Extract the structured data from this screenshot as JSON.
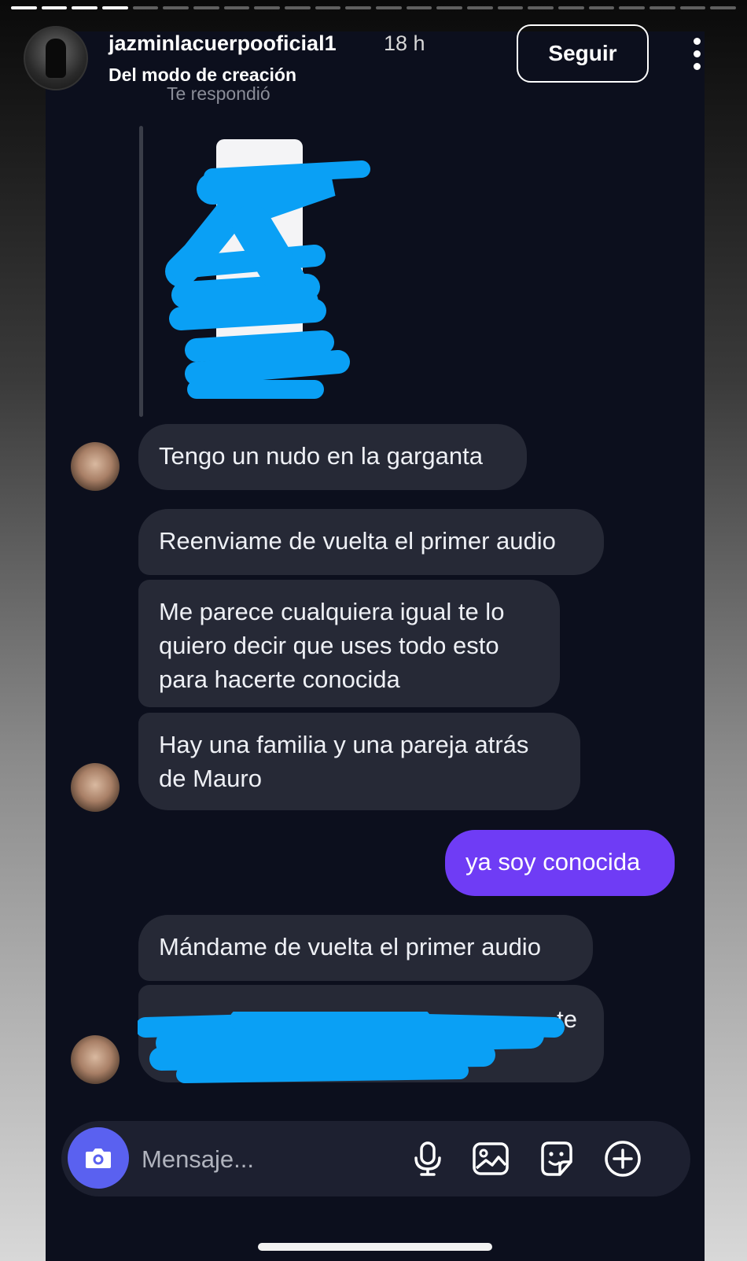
{
  "header": {
    "username": "jazminlacuerpooficial1",
    "time": "18 h",
    "subtitle": "Del modo de creación",
    "follow_label": "Seguir"
  },
  "thread": {
    "replied_label": "Te respondió",
    "messages": [
      {
        "text": "Tengo un nudo en la garganta",
        "from": "them"
      },
      {
        "text": "Reenviame de vuelta el primer audio",
        "from": "them"
      },
      {
        "text": "Me parece cualquiera igual te lo quiero decir que uses todo esto para hacerte conocida",
        "from": "them"
      },
      {
        "text": "Hay una familia y una pareja atrás de Mauro",
        "from": "them"
      },
      {
        "text": "ya soy conocida",
        "from": "me"
      },
      {
        "text": "Mándame de vuelta el primer audio",
        "from": "them"
      }
    ],
    "redacted_visible_fragment": "te"
  },
  "composer": {
    "placeholder": "Mensaje..."
  },
  "icons": [
    "more-vertical-icon",
    "camera-icon",
    "microphone-icon",
    "gallery-icon",
    "sticker-icon",
    "add-icon"
  ],
  "colors": {
    "accent_outgoing": "#6f3cf5",
    "camera_button": "#5a61f0",
    "redaction_scribble": "#0aa0f5",
    "incoming_bubble": "#262936",
    "chat_background": "#0c0f1d"
  }
}
